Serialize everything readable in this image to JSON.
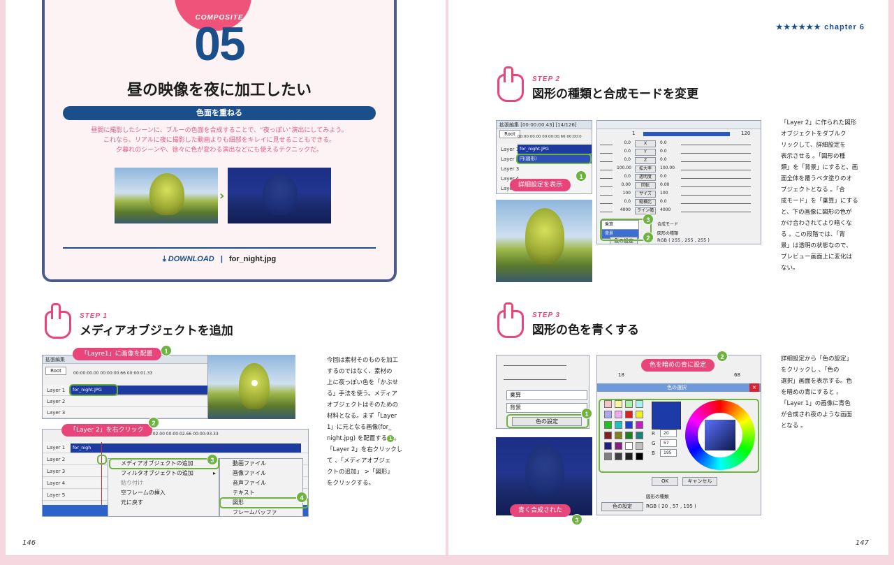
{
  "header": {
    "chapter_stars": "★★★★★★",
    "chapter": "chapter 6",
    "composite": "COMPOSITE",
    "number": "05",
    "title": "昼の映像を夜に加工したい",
    "subtitle": "色面を重ねる",
    "desc_line1": "昼間に撮影したシーンに、ブルーの色面を合成することで、“夜っぽい”演出にしてみよう。",
    "desc_line2": "これなら、リアルに夜に撮影した動画よりも細部をキレイに見せることもできる。",
    "desc_line3": "夕暮れのシーンや、徐々に色が変わる演出などにも使えるテクニックだ。",
    "download_label": "DOWNLOAD",
    "separator": "|",
    "download_file": "for_night.jpg"
  },
  "step1": {
    "label": "STEP 1",
    "title": "メディアオブジェクトを追加",
    "lines": [
      "今回は素材そのものを加工",
      "するのではなく、素材の",
      "上に夜っぽい色を「かぶせ",
      "る」手法を使う。メディア",
      "オブジェクトはそのための",
      "材料となる。まず「Layer",
      "1」に元となる画像(for_",
      "night.jpg) を配置する",
      "「Layer 2」を右クリックし",
      "て 、「メディアオブジェ",
      "クトの追加」 >「図形」",
      "をクリックする。"
    ],
    "win_title": "拡張編集",
    "root": "Root",
    "ruler1": "00:00:00.00   00:00:00.66   00:00:01.33",
    "ruler2": "00:00:01.33   00:00:02.00   00:00:02.66   00:00:03.33",
    "layers": [
      "Layer 1",
      "Layer 2",
      "Layer 3",
      "Layer 4",
      "Layer 5"
    ],
    "clip": "for_night.JPG",
    "clip2": "for_nigh",
    "callout1": "「Layre1」に画像を配置",
    "callout2": "「Layer 2」を右クリック",
    "menu1": [
      "メディアオブジェクトの追加",
      "フィルタオブジェクトの追加",
      "貼り付け",
      "空フレームの挿入",
      "元に戻す"
    ],
    "menu1_arrow": "▸",
    "menu2": [
      "動画ファイル",
      "画像ファイル",
      "音声ファイル",
      "テキスト",
      "図形",
      "フレームバッファ"
    ],
    "badges": [
      "1",
      "2",
      "3",
      "4"
    ]
  },
  "step2": {
    "label": "STEP 2",
    "title": "図形の種類と合成モードを変更",
    "lines": [
      "「Layer 2」に作られた図形",
      "オブジェクトをダブルク",
      "リックして、詳細設定を",
      "表示させる 。「図形の種",
      "類」を「背景」にすると、画",
      "面全体を覆うベタ塗りのオ",
      "ブジェクトとなる 。「合",
      "成モード」を「乗算」にする",
      "と、下の画像に図形の色が",
      "かけ合わされてより暗くな",
      "る 。この段階では、「背",
      "景」は透明の状態なので、",
      "プレビュー画面上に変化は",
      "ない。"
    ],
    "win_title": "拡張編集 [00:00:00.43] [14/126]",
    "root": "Root",
    "ruler": "00:00:00.00   00:00:00.66   00:00:0",
    "layers": [
      "Layer 1",
      "Layer 2",
      "Layer 3",
      "Layer 4",
      "Layer 5"
    ],
    "clip1": "for_night.JPG",
    "clip2": "円(図形)",
    "callout": "詳細設定を表示",
    "frame_start": "1",
    "frame_end": "120",
    "params": [
      "X",
      "Y",
      "Z",
      "拡大率",
      "透明度",
      "回転",
      "サイズ",
      "縦横比",
      "ライン幅"
    ],
    "values": [
      "0.0",
      "0.0",
      "0.0",
      "100.00",
      "0.0",
      "0.00",
      "100",
      "0.0",
      "4000"
    ],
    "right_values": [
      "0.0",
      "0.0",
      "0.0",
      "100.00",
      "0.0",
      "0.00",
      "100",
      "0.0",
      "4000"
    ],
    "blend_options": [
      "乗算",
      "背景"
    ],
    "blend_label": "合成モード",
    "shape_label": "図形の種類",
    "color_btn": "色の設定",
    "color_value": "RGB ( 255 , 255 , 255 )",
    "badges": [
      "1",
      "2",
      "3"
    ]
  },
  "step3": {
    "label": "STEP 3",
    "title": "図形の色を青くする",
    "lines": [
      "詳細設定から「色の設定」",
      "をクリックし 、「色の",
      "選択」画面を表示する。色",
      "を暗めの青にすると 。",
      "「Layer 1」の画像に青色",
      "が合成され夜のような画面",
      "となる 。"
    ],
    "blend": "乗算",
    "shape": "背景",
    "color_btn": "色の設定",
    "frame_start": "18",
    "frame_end": "68",
    "dialog_title": "色の選択",
    "callout1": "色を暗めの青に設定",
    "callout2": "青く合成された",
    "r_label": "R",
    "g_label": "G",
    "b_label": "B",
    "r_val": "20",
    "g_val": "57",
    "b_val": "195",
    "ok": "OK",
    "cancel": "キャンセル",
    "shape_label": "図形の種類",
    "color_value": "RGB ( 20 , 57 , 195 )",
    "badges": [
      "1",
      "2",
      "3"
    ]
  },
  "folios": {
    "left": "146",
    "right": "147"
  },
  "colors": {
    "accent": "#e8467a",
    "navy": "#1a4f8c",
    "green": "#6db33f"
  }
}
